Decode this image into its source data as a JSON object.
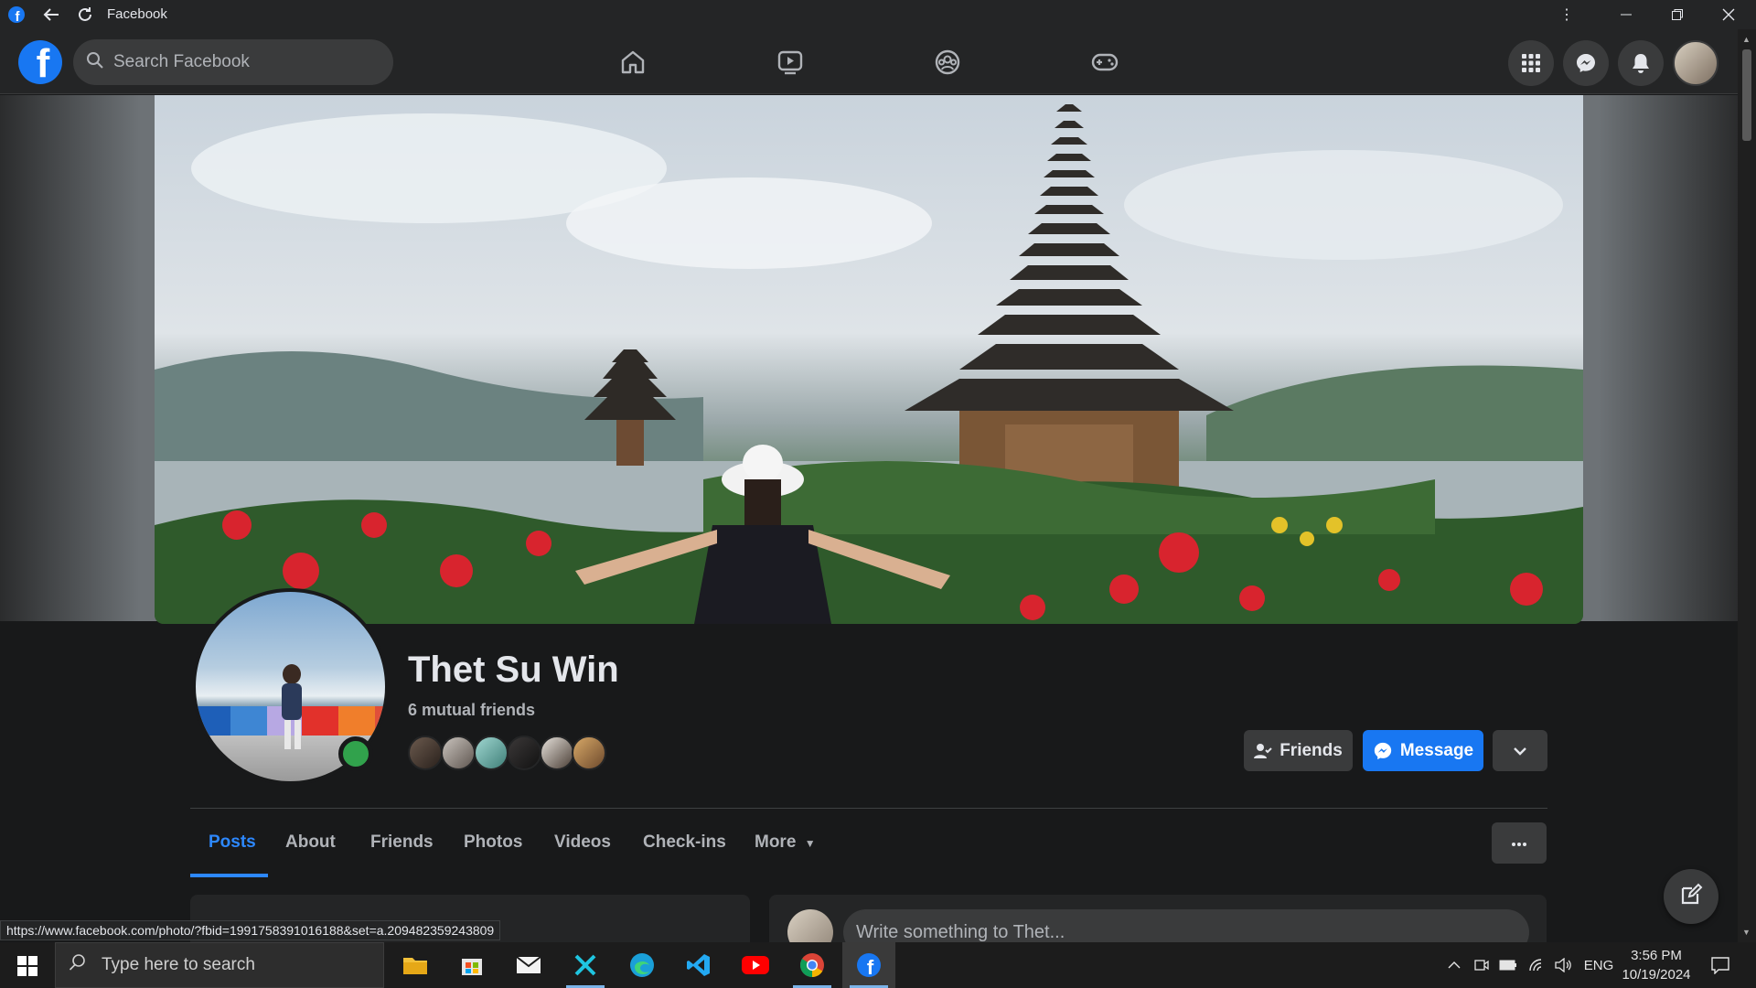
{
  "window": {
    "title": "Facebook"
  },
  "header": {
    "logo_letter": "f",
    "search_placeholder": "Search Facebook",
    "nav_icons": [
      "home-icon",
      "watch-icon",
      "groups-icon",
      "gaming-icon"
    ],
    "right_icons": [
      "menu-grid-icon",
      "messenger-icon",
      "notifications-icon",
      "account-avatar"
    ]
  },
  "profile": {
    "name": "Thet Su Win",
    "mutual_friends": "6 mutual friends",
    "online": true,
    "buttons": {
      "friends": "Friends",
      "message": "Message"
    }
  },
  "tabs": [
    {
      "label": "Posts",
      "active": true
    },
    {
      "label": "About",
      "active": false
    },
    {
      "label": "Friends",
      "active": false
    },
    {
      "label": "Photos",
      "active": false
    },
    {
      "label": "Videos",
      "active": false
    },
    {
      "label": "Check-ins",
      "active": false
    },
    {
      "label": "More",
      "active": false
    }
  ],
  "composer": {
    "placeholder": "Write something to Thet..."
  },
  "status_bar": {
    "url": "https://www.facebook.com/photo/?fbid=1991758391016188&set=a.209482359243809"
  },
  "taskbar": {
    "search_placeholder": "Type here to search",
    "apps": [
      "file-explorer",
      "microsoft-store",
      "mail",
      "capcut",
      "edge",
      "vscode",
      "youtube",
      "chrome",
      "facebook"
    ],
    "language": "ENG",
    "time": "3:56 PM",
    "date": "10/19/2024"
  },
  "colors": {
    "fb_blue": "#1877f2",
    "accent_tab": "#2d88ff",
    "online_green": "#31a24c",
    "background": "#18191a",
    "surface": "#242526"
  }
}
